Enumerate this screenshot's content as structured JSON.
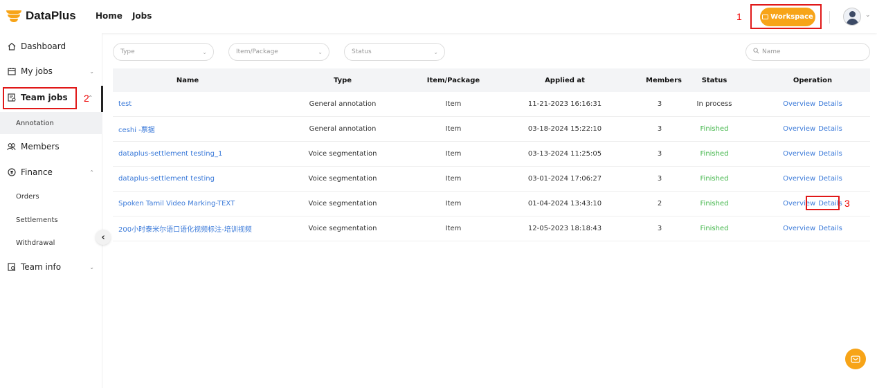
{
  "header": {
    "brand": "DataPlus",
    "nav": [
      "Home",
      "Jobs"
    ],
    "workspace_label": "Workspace",
    "brand_color": "#f7a418"
  },
  "annotations": [
    "1",
    "2",
    "3"
  ],
  "sidebar": {
    "items": [
      {
        "label": "Dashboard",
        "icon": "home-icon"
      },
      {
        "label": "My jobs",
        "icon": "calendar-icon"
      },
      {
        "label": "Team jobs",
        "icon": "team-jobs-icon"
      },
      {
        "label": "Members",
        "icon": "members-icon"
      },
      {
        "label": "Finance",
        "icon": "finance-icon"
      },
      {
        "label": "Team info",
        "icon": "team-info-icon"
      }
    ],
    "team_jobs_sub": [
      "Annotation"
    ],
    "finance_sub": [
      "Orders",
      "Settlements",
      "Withdrawal"
    ]
  },
  "filters": {
    "type_placeholder": "Type",
    "item_package_placeholder": "Item/Package",
    "status_placeholder": "Status",
    "search_placeholder": "Name"
  },
  "table": {
    "headers": [
      "Name",
      "Type",
      "Item/Package",
      "Applied at",
      "Members",
      "Status",
      "Operation"
    ],
    "rows": [
      {
        "name": "test",
        "type": "General annotation",
        "item": "Item",
        "applied": "11-21-2023 16:16:31",
        "members": "3",
        "status": "In process"
      },
      {
        "name": "ceshi -票据",
        "type": "General annotation",
        "item": "Item",
        "applied": "03-18-2024 15:22:10",
        "members": "3",
        "status": "Finished"
      },
      {
        "name": "dataplus-settlement testing_1",
        "type": "Voice segmentation",
        "item": "Item",
        "applied": "03-13-2024 11:25:05",
        "members": "3",
        "status": "Finished"
      },
      {
        "name": "dataplus-settlement testing",
        "type": "Voice segmentation",
        "item": "Item",
        "applied": "03-01-2024 17:06:27",
        "members": "3",
        "status": "Finished"
      },
      {
        "name": "Spoken Tamil Video Marking-TEXT",
        "type": "Voice segmentation",
        "item": "Item",
        "applied": "01-04-2024 13:43:10",
        "members": "2",
        "status": "Finished"
      },
      {
        "name": "200小时泰米尔语口语化视频标注-培训视频",
        "type": "Voice segmentation",
        "item": "Item",
        "applied": "12-05-2023 18:18:43",
        "members": "3",
        "status": "Finished"
      }
    ],
    "op_overview": "Overview",
    "op_details": "Details"
  }
}
